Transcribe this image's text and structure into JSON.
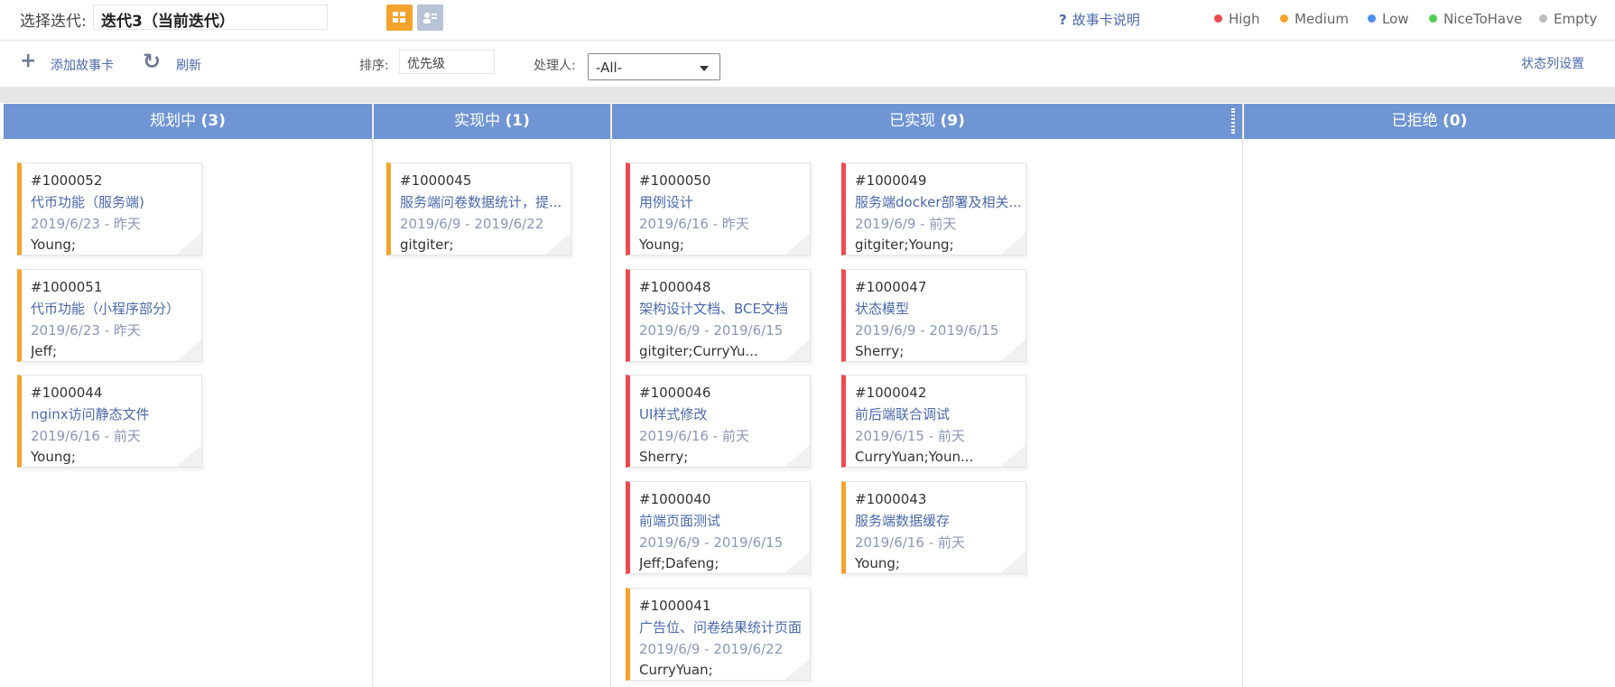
{
  "header": {
    "iteration_label": "选择迭代:",
    "iteration_value": "迭代3（当前迭代）",
    "help_icon": "?",
    "help_text": "故事卡说明",
    "legend": [
      {
        "label": "High",
        "color": "#ef4a4f"
      },
      {
        "label": "Medium",
        "color": "#f5a32c"
      },
      {
        "label": "Low",
        "color": "#4a8ef0"
      },
      {
        "label": "NiceToHave",
        "color": "#4fce4f"
      },
      {
        "label": "Empty",
        "color": "#bdbdbd"
      }
    ]
  },
  "toolbar": {
    "add_icon": "+",
    "add_label": "添加故事卡",
    "refresh_icon": "↻",
    "refresh_label": "刷新",
    "sort_label": "排序:",
    "sort_value": "优先级",
    "owner_label": "处理人:",
    "owner_value": "-All-",
    "column_settings": "状态列设置"
  },
  "columns": [
    {
      "name": "规划中",
      "count": "(3)"
    },
    {
      "name": "实现中",
      "count": "(1)"
    },
    {
      "name": "已实现",
      "count": "(9)"
    },
    {
      "name": "已拒绝",
      "count": "(0)"
    }
  ],
  "cards": {
    "c1000052": {
      "id": "#1000052",
      "title": "代币功能（服务端)",
      "start": "2019/6/23",
      "sep": "-",
      "end": "昨天",
      "owner": "Young;",
      "priority": "Medium"
    },
    "c1000051": {
      "id": "#1000051",
      "title": "代币功能（小程序部分）",
      "start": "2019/6/23",
      "sep": "-",
      "end": "昨天",
      "owner": "Jeff;",
      "priority": "Medium"
    },
    "c1000044": {
      "id": "#1000044",
      "title": "nginx访问静态文件",
      "start": "2019/6/16",
      "sep": "-",
      "end": "前天",
      "owner": "Young;",
      "priority": "Medium"
    },
    "c1000045": {
      "id": "#1000045",
      "title": "服务端问卷数据统计，提...",
      "start": "2019/6/9",
      "sep": "-",
      "end": "2019/6/22",
      "owner": "gitgiter;",
      "priority": "Medium"
    },
    "c1000050": {
      "id": "#1000050",
      "title": "用例设计",
      "start": "2019/6/16",
      "sep": "-",
      "end": "昨天",
      "owner": "Young;",
      "priority": "High"
    },
    "c1000048": {
      "id": "#1000048",
      "title": "架构设计文档、BCE文档",
      "start": "2019/6/9",
      "sep": "-",
      "end": "2019/6/15",
      "owner": "gitgiter;CurryYu...",
      "priority": "High"
    },
    "c1000046": {
      "id": "#1000046",
      "title": "UI样式修改",
      "start": "2019/6/16",
      "sep": "-",
      "end": "前天",
      "owner": "Sherry;",
      "priority": "High"
    },
    "c1000040": {
      "id": "#1000040",
      "title": "前端页面测试",
      "start": "2019/6/9",
      "sep": "-",
      "end": "2019/6/15",
      "owner": "Jeff;Dafeng;",
      "priority": "High"
    },
    "c1000041": {
      "id": "#1000041",
      "title": "广告位、问卷结果统计页面",
      "start": "2019/6/9",
      "sep": "-",
      "end": "2019/6/22",
      "owner": "CurryYuan;",
      "priority": "Medium"
    },
    "c1000049": {
      "id": "#1000049",
      "title": "服务端docker部署及相关...",
      "start": "2019/6/9",
      "sep": "-",
      "end": "前天",
      "owner": "gitgiter;Young;",
      "priority": "High"
    },
    "c1000047": {
      "id": "#1000047",
      "title": "状态模型",
      "start": "2019/6/9",
      "sep": "-",
      "end": "2019/6/15",
      "owner": "Sherry;",
      "priority": "High"
    },
    "c1000042": {
      "id": "#1000042",
      "title": "前后端联合调试",
      "start": "2019/6/15",
      "sep": "-",
      "end": "前天",
      "owner": "CurryYuan;Youn...",
      "priority": "High"
    },
    "c1000043": {
      "id": "#1000043",
      "title": "服务端数据缓存",
      "start": "2019/6/16",
      "sep": "-",
      "end": "前天",
      "owner": "Young;",
      "priority": "Medium"
    }
  }
}
